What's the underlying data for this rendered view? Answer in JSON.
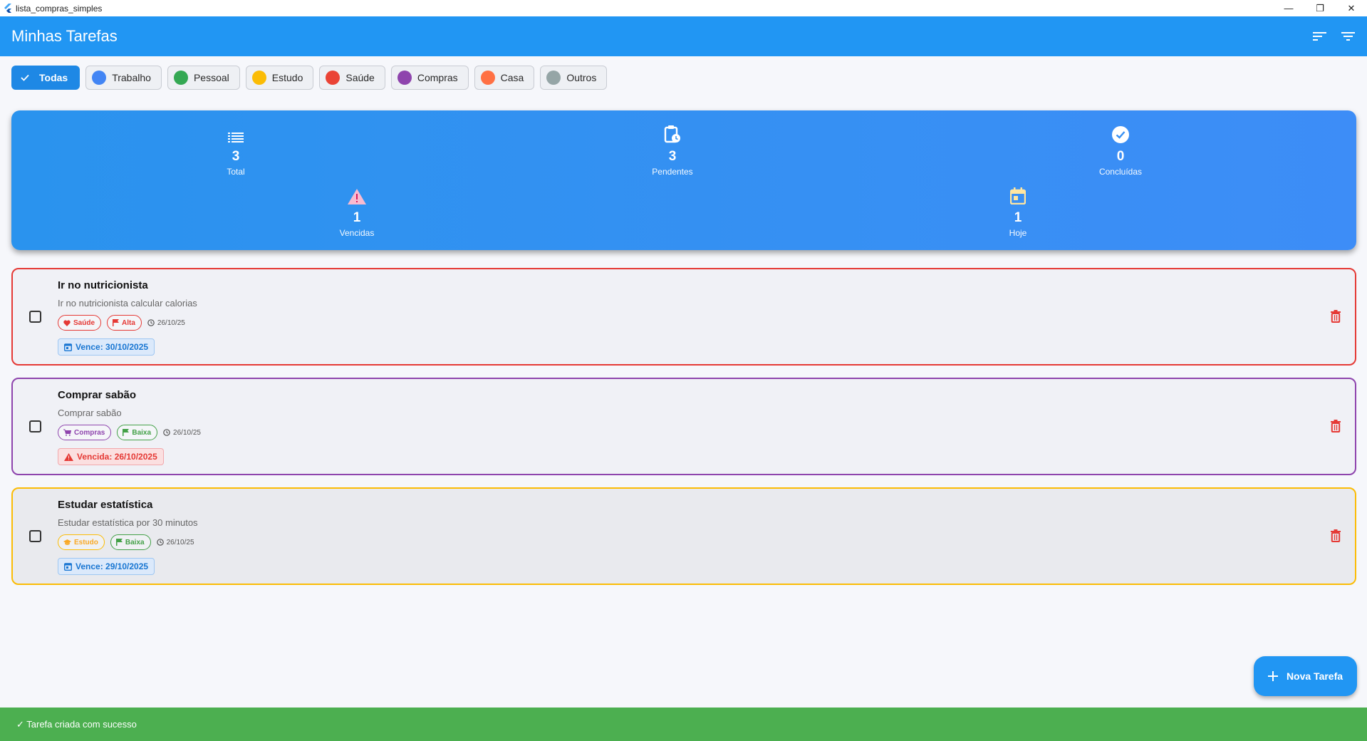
{
  "window": {
    "title": "lista_compras_simples",
    "controls": {
      "minimize": "—",
      "restore": "❐",
      "close": "✕"
    }
  },
  "appbar": {
    "title": "Minhas Tarefas",
    "actions": [
      "sort-icon",
      "filter-icon"
    ]
  },
  "categories": [
    {
      "label": "Todas",
      "active": true
    },
    {
      "label": "Trabalho",
      "color": "#4285f4"
    },
    {
      "label": "Pessoal",
      "color": "#34a853"
    },
    {
      "label": "Estudo",
      "color": "#fbbc05"
    },
    {
      "label": "Saúde",
      "color": "#ea4335"
    },
    {
      "label": "Compras",
      "color": "#8e44ad"
    },
    {
      "label": "Casa",
      "color": "#ff7043"
    },
    {
      "label": "Outros",
      "color": "#95a5a6"
    }
  ],
  "stats": {
    "total": {
      "value": "3",
      "label": "Total",
      "icon": "list-icon"
    },
    "pending": {
      "value": "3",
      "label": "Pendentes",
      "icon": "pending-clipboard-icon"
    },
    "done": {
      "value": "0",
      "label": "Concluídas",
      "icon": "check-circle-icon"
    },
    "overdue": {
      "value": "1",
      "label": "Vencidas",
      "icon": "warning-icon"
    },
    "today": {
      "value": "1",
      "label": "Hoje",
      "icon": "calendar-today-icon"
    }
  },
  "tasks": [
    {
      "title": "Ir no nutricionista",
      "description": "Ir no nutricionista calcular calorias",
      "category": "Saúde",
      "priority": "Alta",
      "created": "26/10/25",
      "due": "Vence: 30/10/2025",
      "border_color": "#e53935"
    },
    {
      "title": "Comprar sabão",
      "description": "Comprar sabão",
      "category": "Compras",
      "priority": "Baixa",
      "created": "26/10/25",
      "due": "Vencida: 26/10/2025",
      "border_color": "#8e44ad"
    },
    {
      "title": "Estudar estatística",
      "description": "Estudar estatística por 30 minutos",
      "category": "Estudo",
      "priority": "Baixa",
      "created": "26/10/25",
      "due": "Vence: 29/10/2025",
      "border_color": "#fbbc05"
    }
  ],
  "fab": {
    "label": "Nova Tarefa",
    "icon": "add-icon"
  },
  "snackbar": {
    "message": "✓ Tarefa criada com sucesso"
  },
  "colors": {
    "primary": "#2196f3",
    "success": "#4caf50",
    "danger": "#e53935"
  }
}
